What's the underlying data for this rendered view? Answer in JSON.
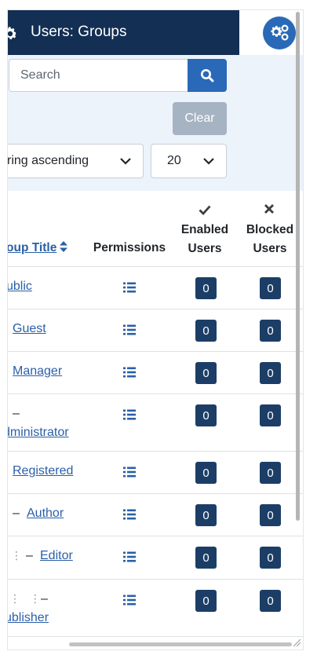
{
  "header": {
    "title": "Users: Groups"
  },
  "filters": {
    "search_placeholder": "Search",
    "clear_label": "Clear",
    "ordering_value": "ring ascending",
    "limit_value": "20"
  },
  "table": {
    "columns": {
      "group_title": "roup Title",
      "permissions": "Permissions",
      "enabled_line1": "Enabled",
      "enabled_line2": "Users",
      "blocked_line1": "Blocked",
      "blocked_line2": "Users"
    },
    "rows": [
      {
        "title": "ublic",
        "enabled": "0",
        "blocked": "0"
      },
      {
        "title": "Guest",
        "enabled": "0",
        "blocked": "0"
      },
      {
        "title": "Manager",
        "enabled": "0",
        "blocked": "0"
      },
      {
        "prefix": "–",
        "title": "dministrator",
        "enabled": "0",
        "blocked": "0"
      },
      {
        "title": "Registered",
        "enabled": "0",
        "blocked": "0"
      },
      {
        "prefix": "–",
        "title": "Author",
        "enabled": "0",
        "blocked": "0"
      },
      {
        "dots": "⋮",
        "prefix": "–",
        "title": "Editor",
        "enabled": "0",
        "blocked": "0"
      },
      {
        "dots": "⋮ ⋮",
        "prefix": "–",
        "title": "ublisher",
        "enabled": "0",
        "blocked": "0"
      }
    ]
  },
  "colors": {
    "header_bg": "#132f53",
    "accent": "#2a69b8",
    "filter_bg": "#edf3fb",
    "badge_bg": "#1c3e66",
    "link": "#2a5fa7",
    "clear_bg": "#a6b3c2"
  },
  "icons": {
    "header": "gear-icon",
    "options": "cogs-icon",
    "search": "search-icon",
    "select": "chevron-down-icon",
    "enabled": "check-icon",
    "blocked": "times-icon",
    "permissions": "list-icon",
    "sort": "sort-icon"
  }
}
